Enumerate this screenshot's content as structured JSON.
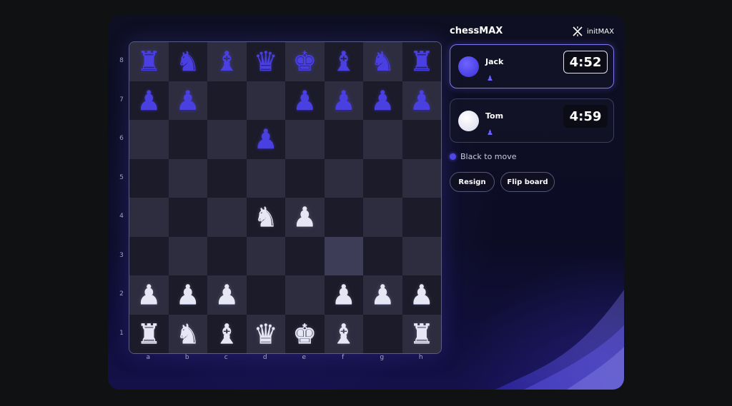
{
  "app": {
    "brand": "chessMAX",
    "logo_text": "initMAX"
  },
  "board": {
    "ranks": [
      "8",
      "7",
      "6",
      "5",
      "4",
      "3",
      "2",
      "1"
    ],
    "files": [
      "a",
      "b",
      "c",
      "d",
      "e",
      "f",
      "g",
      "h"
    ],
    "rows": [
      [
        "bR",
        "bN",
        "bB",
        "bQ",
        "bK",
        "bB",
        "bN",
        "bR"
      ],
      [
        "bP",
        "bP",
        "",
        "",
        "bP",
        "bP",
        "bP",
        "bP"
      ],
      [
        "",
        "",
        "",
        "bP",
        "",
        "",
        "",
        ""
      ],
      [
        "",
        "",
        "",
        "",
        "",
        "",
        "",
        ""
      ],
      [
        "",
        "",
        "",
        "wN",
        "wP",
        "",
        "",
        ""
      ],
      [
        "",
        "",
        "",
        "",
        "",
        "",
        "",
        ""
      ],
      [
        "wP",
        "wP",
        "wP",
        "",
        "",
        "wP",
        "wP",
        "wP"
      ],
      [
        "wR",
        "wN",
        "wB",
        "wQ",
        "wK",
        "wB",
        "",
        "wR"
      ]
    ],
    "highlight": "f3",
    "light_color": "#2e2d40",
    "dark_color": "#1b1b29",
    "highlight_color": "#3e3d58"
  },
  "players": [
    {
      "name": "Jack",
      "clock": "4:52",
      "color": "black",
      "active": true,
      "captured": "♟"
    },
    {
      "name": "Tom",
      "clock": "4:59",
      "color": "white",
      "active": false,
      "captured": "♟"
    }
  ],
  "status": {
    "text": "Black to move"
  },
  "buttons": {
    "resign": "Resign",
    "flip": "Flip board"
  },
  "colors": {
    "accent": "#5146e8",
    "black_piece": "#4a3fe0",
    "white_piece": "#e6e6f4"
  }
}
